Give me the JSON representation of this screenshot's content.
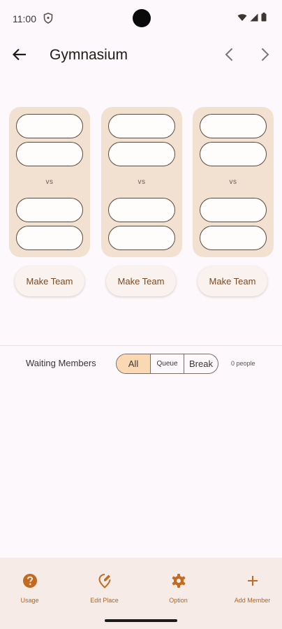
{
  "status_bar": {
    "time": "11:00"
  },
  "app_bar": {
    "title": "Gymnasium"
  },
  "courts": [
    {
      "vs_label": "vs",
      "button_label": "Make Team"
    },
    {
      "vs_label": "vs",
      "button_label": "Make Team"
    },
    {
      "vs_label": "vs",
      "button_label": "Make Team"
    }
  ],
  "waiting": {
    "label": "Waiting Members",
    "filters": [
      "All",
      "Queue",
      "Break"
    ],
    "selected_filter": "All",
    "count_text": "0 people"
  },
  "bottom_nav": {
    "items": [
      {
        "label": "Usage",
        "icon": "help-circle-icon"
      },
      {
        "label": "Edit Place",
        "icon": "edit-location-icon"
      },
      {
        "label": "Option",
        "icon": "gear-icon"
      },
      {
        "label": "Add Member",
        "icon": "plus-icon"
      }
    ]
  },
  "colors": {
    "background": "#fdf8fb",
    "court_card": "#f2e1d1",
    "accent": "#b5651d",
    "selected_segment": "#fbd8b4",
    "bottom_nav": "#f6ebe6"
  }
}
